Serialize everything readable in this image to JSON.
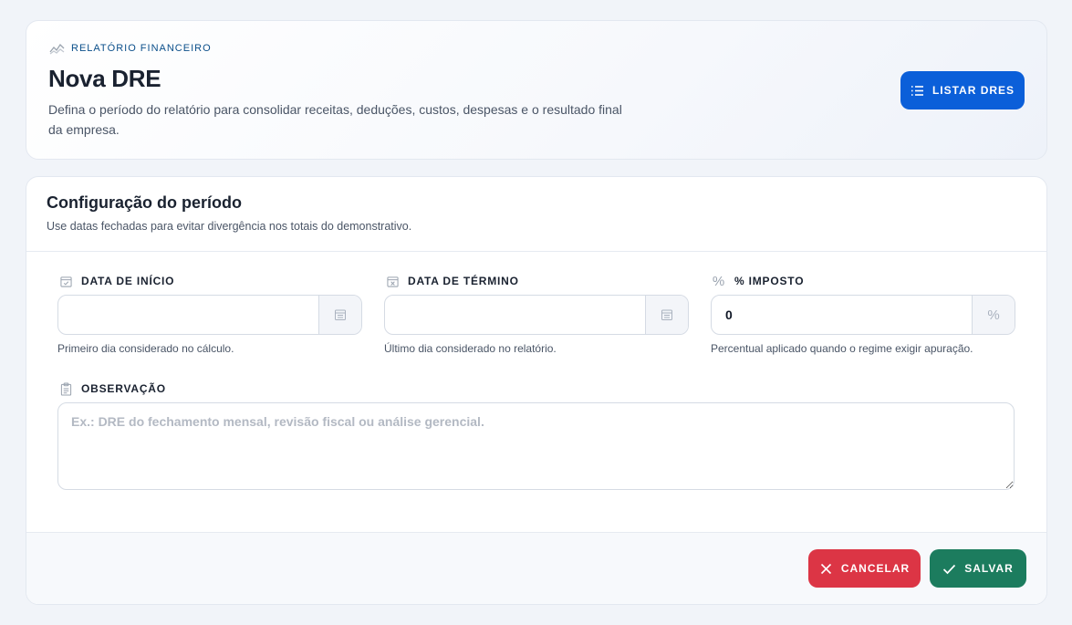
{
  "header": {
    "eyebrow": "RELATÓRIO FINANCEIRO",
    "eyebrow_icon": "chart-line-icon",
    "title": "Nova DRE",
    "description": "Defina o período do relatório para consolidar receitas, deduções, custos, despesas e o resultado final da empresa.",
    "list_button": {
      "label": "LISTAR DRES",
      "icon": "list-icon",
      "color": "#0b5fd9"
    }
  },
  "form": {
    "section_title": "Configuração do período",
    "section_subtitle": "Use datas fechadas para evitar divergência nos totais do demonstrativo.",
    "fields": {
      "start_date": {
        "label": "DATA DE INÍCIO",
        "icon": "calendar-check-icon",
        "value": "",
        "addon_icon": "calendar-icon",
        "hint": "Primeiro dia considerado no cálculo."
      },
      "end_date": {
        "label": "DATA DE TÉRMINO",
        "icon": "calendar-x-icon",
        "value": "",
        "addon_icon": "calendar-icon",
        "hint": "Último dia considerado no relatório."
      },
      "tax": {
        "label": "% IMPOSTO",
        "icon": "percent-icon",
        "value": "0",
        "addon": "%",
        "hint": "Percentual aplicado quando o regime exigir apuração."
      },
      "notes": {
        "label": "OBSERVAÇÃO",
        "icon": "clipboard-icon",
        "value": "",
        "placeholder": "Ex.: DRE do fechamento mensal, revisão fiscal ou análise gerencial."
      }
    }
  },
  "footer": {
    "cancel_button": {
      "label": "CANCELAR",
      "icon": "close-icon",
      "color": "#dc3545"
    },
    "save_button": {
      "label": "SALVAR",
      "icon": "check-icon",
      "color": "#1c7c5e"
    }
  }
}
